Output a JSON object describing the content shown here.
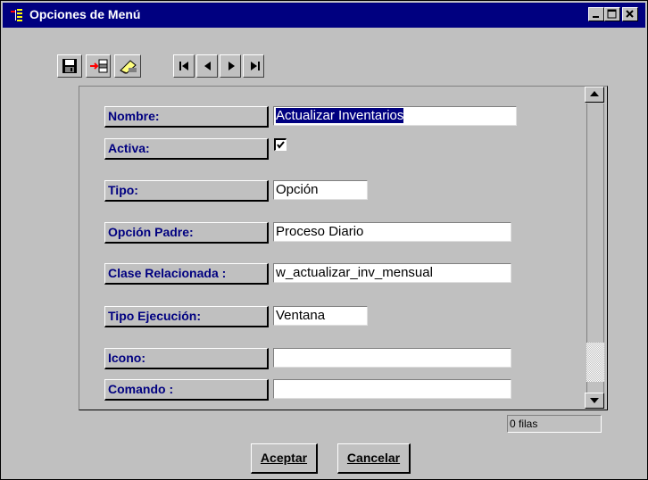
{
  "window": {
    "title": "Opciones de Menú"
  },
  "toolbar": {
    "icons": [
      "save-icon",
      "insert-row-icon",
      "delete-icon"
    ],
    "nav_icons": [
      "first-record-icon",
      "prev-record-icon",
      "next-record-icon",
      "last-record-icon"
    ]
  },
  "form": {
    "nombre": {
      "label": "Nombre:",
      "value": "Actualizar Inventarios"
    },
    "activa": {
      "label": "Activa:",
      "checked": true
    },
    "tipo": {
      "label": "Tipo:",
      "value": "Opción"
    },
    "opcion_padre": {
      "label": "Opción Padre:",
      "value": "Proceso Diario"
    },
    "clase": {
      "label": "Clase Relacionada :",
      "value": "w_actualizar_inv_mensual"
    },
    "tipo_ejec": {
      "label": "Tipo Ejecución:",
      "value": "Ventana"
    },
    "icono": {
      "label": "Icono:",
      "value": ""
    },
    "comando": {
      "label": "Comando  :",
      "value": ""
    }
  },
  "status": {
    "rows": "0 filas"
  },
  "buttons": {
    "aceptar": "Aceptar",
    "cancelar": "Cancelar"
  },
  "colors": {
    "titlebar": "#000080",
    "label_text": "#000080",
    "face": "#c0c0c0"
  }
}
